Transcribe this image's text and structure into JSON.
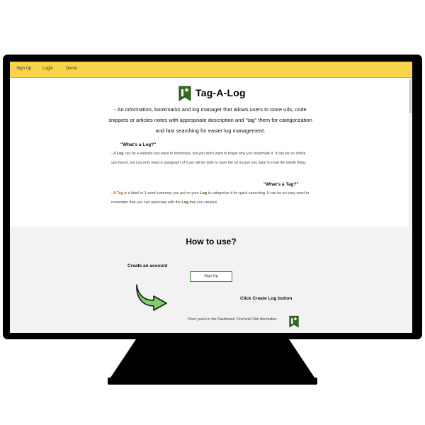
{
  "nav": {
    "items": [
      "Sign Up",
      "Login",
      "Demo"
    ]
  },
  "brand": {
    "name": "Tag-A-Log"
  },
  "intro": {
    "description": "- An information, bookmarks and log manager that allows users to store urls, code snippets or articles notes with appropriate description and \"tag\" them for categorization and fast searching for easier log management."
  },
  "log_section": {
    "heading": "\"What's a Log?\"",
    "p1": "- A ",
    "log_word": "Log",
    "p2": " can be a website you want to bookmark, but you don't want to forget why you bookmark it. It can be an article you found, but you only need a paragraph of it yet still be able to save the url incase you want to read the whole thing."
  },
  "tag_section": {
    "heading": "\"What's a Tag?\"",
    "p1": "- A ",
    "tag_word": "Tag",
    "p2": " is a label or 1 word summary you put on your ",
    "log_word": "Log",
    "p3": " to categorize it for quick searching. It can be an easy word to remember that you can associate with the ",
    "log_word_2": "Log",
    "p4": " that you created."
  },
  "how_to": {
    "title": "How to use?",
    "step1_label": "Create an account",
    "signup_button": "Sign Up",
    "step2_label": "Click Create Log button",
    "step2_text": "Once you're in the Dashboard. Find and Click this button:"
  },
  "icons": [
    "tag-log-logo-icon",
    "curved-arrow-icon"
  ],
  "colors": {
    "navbar": "#f8d44a",
    "brand_green": "#2e6a1a",
    "tag_orange": "#e2621b",
    "section_bg": "#f2f2f2"
  }
}
